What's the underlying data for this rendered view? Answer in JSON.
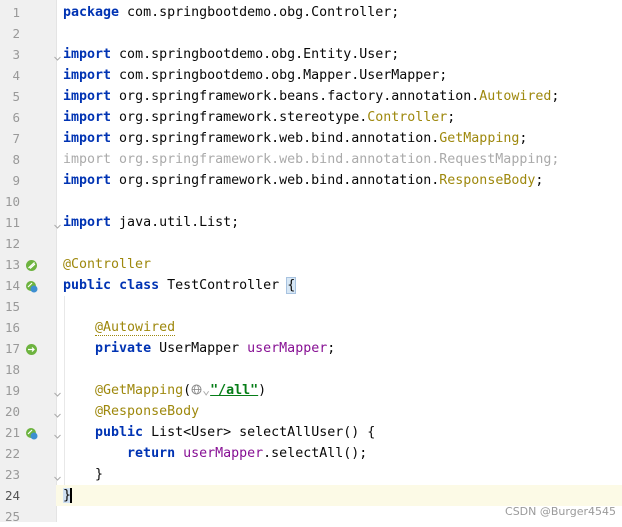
{
  "lines": [
    {
      "n": "1",
      "parts": [
        {
          "k": "kw",
          "t": "package"
        },
        {
          "k": "",
          "t": " com.springbootdemo.obg.Controller;"
        }
      ]
    },
    {
      "n": "2",
      "parts": []
    },
    {
      "n": "3",
      "fold": true,
      "parts": [
        {
          "k": "kw",
          "t": "import"
        },
        {
          "k": "",
          "t": " com.springbootdemo.obg.Entity.User;"
        }
      ]
    },
    {
      "n": "4",
      "parts": [
        {
          "k": "kw",
          "t": "import"
        },
        {
          "k": "",
          "t": " com.springbootdemo.obg.Mapper.UserMapper;"
        }
      ]
    },
    {
      "n": "5",
      "parts": [
        {
          "k": "kw",
          "t": "import"
        },
        {
          "k": "",
          "t": " org.springframework.beans.factory.annotation."
        },
        {
          "k": "ann",
          "t": "Autowired"
        },
        {
          "k": "",
          "t": ";"
        }
      ]
    },
    {
      "n": "6",
      "parts": [
        {
          "k": "kw",
          "t": "import"
        },
        {
          "k": "",
          "t": " org.springframework.stereotype."
        },
        {
          "k": "ann",
          "t": "Controller"
        },
        {
          "k": "",
          "t": ";"
        }
      ]
    },
    {
      "n": "7",
      "parts": [
        {
          "k": "kw",
          "t": "import"
        },
        {
          "k": "",
          "t": " org.springframework.web.bind.annotation."
        },
        {
          "k": "ann",
          "t": "GetMapping"
        },
        {
          "k": "",
          "t": ";"
        }
      ]
    },
    {
      "n": "8",
      "parts": [
        {
          "k": "faded-b",
          "t": "import"
        },
        {
          "k": "faded",
          "t": " org.springframework.web.bind.annotation.RequestMapping;"
        }
      ]
    },
    {
      "n": "9",
      "parts": [
        {
          "k": "kw",
          "t": "import"
        },
        {
          "k": "",
          "t": " org.springframework.web.bind.annotation."
        },
        {
          "k": "ann",
          "t": "ResponseBody"
        },
        {
          "k": "",
          "t": ";"
        }
      ]
    },
    {
      "n": "10",
      "parts": []
    },
    {
      "n": "11",
      "fold": true,
      "parts": [
        {
          "k": "kw",
          "t": "import"
        },
        {
          "k": "",
          "t": " java.util.List;"
        }
      ]
    },
    {
      "n": "12",
      "parts": []
    },
    {
      "n": "13",
      "icon": "bean-class-icon",
      "parts": [
        {
          "k": "ann",
          "t": "@Controller"
        }
      ]
    },
    {
      "n": "14",
      "icon": "spring-web-icon",
      "parts": [
        {
          "k": "kw",
          "t": "public"
        },
        {
          "k": "",
          "t": " "
        },
        {
          "k": "kw",
          "t": "class"
        },
        {
          "k": "",
          "t": " TestController "
        },
        {
          "k": "brace",
          "t": "{"
        }
      ]
    },
    {
      "n": "15",
      "parts": []
    },
    {
      "n": "16",
      "parts": [
        {
          "k": "",
          "t": "    "
        },
        {
          "k": "ann-b",
          "t": "@Autowired"
        }
      ]
    },
    {
      "n": "17",
      "icon": "injection-point-icon",
      "parts": [
        {
          "k": "",
          "t": "    "
        },
        {
          "k": "kw",
          "t": "private"
        },
        {
          "k": "",
          "t": " UserMapper "
        },
        {
          "k": "fld",
          "t": "userMapper"
        },
        {
          "k": "",
          "t": ";"
        }
      ]
    },
    {
      "n": "18",
      "parts": []
    },
    {
      "n": "19",
      "fold": true,
      "parts": [
        {
          "k": "",
          "t": "    "
        },
        {
          "k": "ann",
          "t": "@GetMapping"
        },
        {
          "k": "",
          "t": "("
        },
        {
          "k": "globe",
          "t": ""
        },
        {
          "k": "faded",
          "t": "⌄"
        },
        {
          "k": "str",
          "t": "\"/all\""
        },
        {
          "k": "",
          "t": ")"
        }
      ]
    },
    {
      "n": "20",
      "fold": true,
      "parts": [
        {
          "k": "",
          "t": "    "
        },
        {
          "k": "ann",
          "t": "@ResponseBody"
        }
      ]
    },
    {
      "n": "21",
      "icon": "request-mapping-icon",
      "fold": true,
      "parts": [
        {
          "k": "",
          "t": "    "
        },
        {
          "k": "kw",
          "t": "public"
        },
        {
          "k": "",
          "t": " List<User> selectAllUser() {"
        }
      ]
    },
    {
      "n": "22",
      "parts": [
        {
          "k": "",
          "t": "        "
        },
        {
          "k": "kw",
          "t": "return"
        },
        {
          "k": "",
          "t": " "
        },
        {
          "k": "fld",
          "t": "userMapper"
        },
        {
          "k": "",
          "t": ".selectAll();"
        }
      ]
    },
    {
      "n": "23",
      "fold": true,
      "parts": [
        {
          "k": "",
          "t": "    }"
        }
      ]
    },
    {
      "n": "24",
      "current": true,
      "parts": [
        {
          "k": "caret-brace",
          "t": "}"
        }
      ]
    },
    {
      "n": "25",
      "parts": []
    }
  ],
  "watermark": "CSDN @Burger4545",
  "colors": {
    "keyword": "#0033b3",
    "annotation": "#9e880d",
    "field": "#871094",
    "string": "#067d17",
    "current_line": "#fcfae6"
  }
}
